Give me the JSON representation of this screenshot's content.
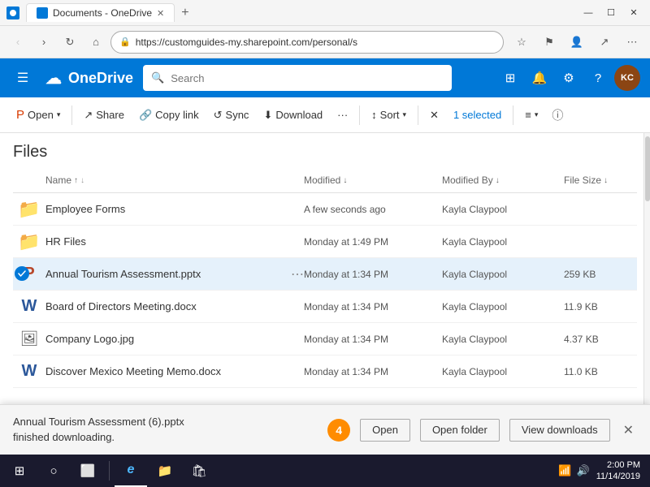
{
  "browser": {
    "tab_title": "Documents - OneDrive",
    "url": "https://customguides-my.sharepoint.com/personal/s",
    "new_tab_label": "+",
    "window_controls": {
      "minimize": "—",
      "maximize": "☐",
      "close": "✕"
    }
  },
  "nav": {
    "back": "‹",
    "forward": "›",
    "refresh": "↻",
    "home": "⌂"
  },
  "header": {
    "menu_icon": "≡",
    "app_name": "OneDrive",
    "search_placeholder": "Search",
    "apps_icon": "⊞",
    "notifications_icon": "🔔",
    "settings_icon": "⚙",
    "help_icon": "?",
    "avatar_text": "KC"
  },
  "ribbon": {
    "open_label": "Open",
    "share_label": "Share",
    "copy_link_label": "Copy link",
    "sync_label": "Sync",
    "download_label": "Download",
    "more_label": "···",
    "sort_label": "Sort",
    "selected_label": "1 selected",
    "layout_icon": "≡",
    "info_icon": "ⓘ"
  },
  "files_heading": "Files",
  "columns": {
    "name": "Name",
    "modified": "Modified",
    "modified_by": "Modified By",
    "file_size": "File Size"
  },
  "files": [
    {
      "name": "Employee Forms",
      "type": "folder",
      "modified": "A few seconds ago",
      "modified_by": "Kayla Claypool",
      "size": ""
    },
    {
      "name": "HR Files",
      "type": "folder",
      "modified": "Monday at 1:49 PM",
      "modified_by": "Kayla Claypool",
      "size": ""
    },
    {
      "name": "Annual Tourism Assessment.pptx",
      "type": "pptx",
      "modified": "Monday at 1:34 PM",
      "modified_by": "Kayla Claypool",
      "size": "259 KB",
      "selected": true
    },
    {
      "name": "Board of Directors Meeting.docx",
      "type": "docx",
      "modified": "Monday at 1:34 PM",
      "modified_by": "Kayla Claypool",
      "size": "11.9 KB"
    },
    {
      "name": "Company Logo.jpg",
      "type": "jpg",
      "modified": "Monday at 1:34 PM",
      "modified_by": "Kayla Claypool",
      "size": "4.37 KB"
    },
    {
      "name": "Discover Mexico Meeting Memo.docx",
      "type": "docx",
      "modified": "Monday at 1:34 PM",
      "modified_by": "Kayla Claypool",
      "size": "11.0 KB"
    }
  ],
  "download_bar": {
    "filename": "Annual Tourism Assessment (6).pptx",
    "status": "finished downloading.",
    "step_number": "4",
    "open_label": "Open",
    "open_folder_label": "Open folder",
    "view_downloads_label": "View downloads",
    "close_icon": "✕"
  },
  "taskbar": {
    "start_icon": "⊞",
    "search_icon": "○",
    "task_view_icon": "⬜",
    "edge_icon": "e",
    "file_explorer_icon": "📁",
    "store_icon": "🛍",
    "time": "2:00 PM",
    "date": "11/14/2019"
  }
}
